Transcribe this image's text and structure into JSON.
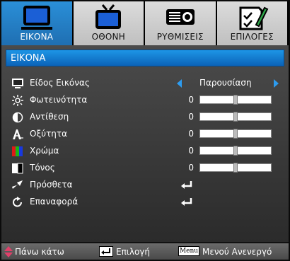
{
  "tabs": [
    {
      "label": "ΕΙΚΟΝΑ",
      "icon": "monitor-icon",
      "active": true
    },
    {
      "label": "ΟΘΟΝΗ",
      "icon": "tv-icon",
      "active": false
    },
    {
      "label": "ΡΥΘΜΙΣΕΙΣ",
      "icon": "projector-icon",
      "active": false
    },
    {
      "label": "ΕΠΙΛΟΓΕΣ",
      "icon": "checklist-pen-icon",
      "active": false
    }
  ],
  "panel": {
    "title": "ΕΙΚΟΝΑ"
  },
  "rows": [
    {
      "label": "Είδος Εικόνας",
      "type": "selector",
      "value": "Παρουσίαση",
      "icon": "monitor-small-icon"
    },
    {
      "label": "Φωτεινότητα",
      "type": "slider",
      "value": "0",
      "level": 0.5,
      "icon": "brightness-icon"
    },
    {
      "label": "Αντίθεση",
      "type": "slider",
      "value": "0",
      "level": 0.5,
      "icon": "contrast-icon"
    },
    {
      "label": "Οξύτητα",
      "type": "slider",
      "value": "0",
      "level": 0.5,
      "icon": "sharpness-icon"
    },
    {
      "label": "Χρώμα",
      "type": "slider",
      "value": "0",
      "level": 0.5,
      "icon": "color-icon"
    },
    {
      "label": "Τόνος",
      "type": "slider",
      "value": "0",
      "level": 0.5,
      "icon": "tint-icon"
    },
    {
      "label": "Πρόσθετα",
      "type": "enter",
      "icon": "advanced-icon"
    },
    {
      "label": "Επαναφορά",
      "type": "enter",
      "icon": "reset-icon"
    }
  ],
  "footer": {
    "nav_label": "Πάνω κάτω",
    "select_label": "Επιλογή",
    "menu_key": "Menu",
    "menu_label": "Μενού Ανενεργό"
  },
  "colors": {
    "accent": "#1f7fd0",
    "arrow": "#2d9cf0",
    "nav_arrow": "#e0406a"
  }
}
